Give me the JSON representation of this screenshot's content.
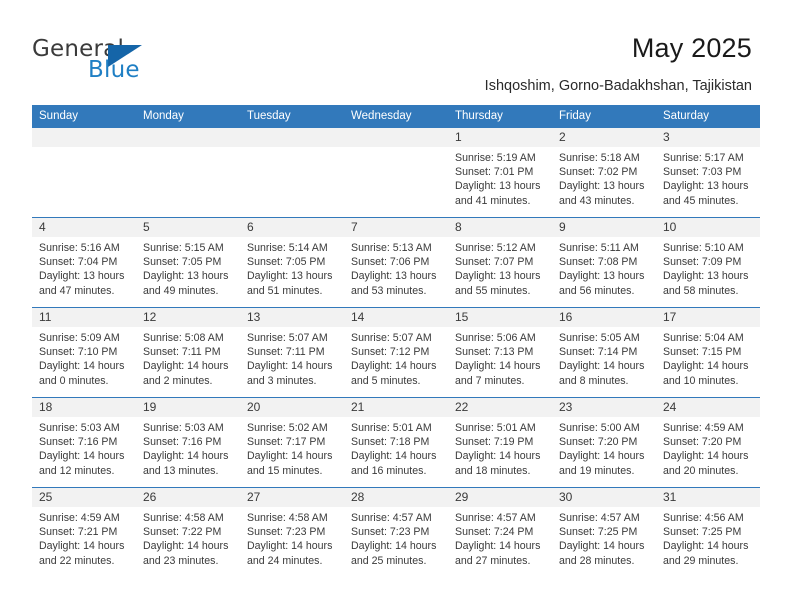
{
  "brand": {
    "name_top": "General",
    "name_bottom": "Blue",
    "triangle_color": "#1565a8",
    "blue_color": "#1f7fc4"
  },
  "header": {
    "title": "May 2025",
    "subtitle": "Ishqoshim, Gorno-Badakhshan, Tajikistan"
  },
  "theme": {
    "header_bg": "#3279bb",
    "daynum_bg": "#f2f2f2",
    "text": "#3a3a3a"
  },
  "calendar": {
    "weekday_headers": [
      "Sunday",
      "Monday",
      "Tuesday",
      "Wednesday",
      "Thursday",
      "Friday",
      "Saturday"
    ],
    "labels": {
      "sunrise": "Sunrise:",
      "sunset": "Sunset:",
      "daylight": "Daylight:"
    },
    "weeks": [
      [
        {
          "day": "",
          "empty": true
        },
        {
          "day": "",
          "empty": true
        },
        {
          "day": "",
          "empty": true
        },
        {
          "day": "",
          "empty": true
        },
        {
          "day": "1",
          "sunrise": "Sunrise: 5:19 AM",
          "sunset": "Sunset: 7:01 PM",
          "daylight": "Daylight: 13 hours and 41 minutes."
        },
        {
          "day": "2",
          "sunrise": "Sunrise: 5:18 AM",
          "sunset": "Sunset: 7:02 PM",
          "daylight": "Daylight: 13 hours and 43 minutes."
        },
        {
          "day": "3",
          "sunrise": "Sunrise: 5:17 AM",
          "sunset": "Sunset: 7:03 PM",
          "daylight": "Daylight: 13 hours and 45 minutes."
        }
      ],
      [
        {
          "day": "4",
          "sunrise": "Sunrise: 5:16 AM",
          "sunset": "Sunset: 7:04 PM",
          "daylight": "Daylight: 13 hours and 47 minutes."
        },
        {
          "day": "5",
          "sunrise": "Sunrise: 5:15 AM",
          "sunset": "Sunset: 7:05 PM",
          "daylight": "Daylight: 13 hours and 49 minutes."
        },
        {
          "day": "6",
          "sunrise": "Sunrise: 5:14 AM",
          "sunset": "Sunset: 7:05 PM",
          "daylight": "Daylight: 13 hours and 51 minutes."
        },
        {
          "day": "7",
          "sunrise": "Sunrise: 5:13 AM",
          "sunset": "Sunset: 7:06 PM",
          "daylight": "Daylight: 13 hours and 53 minutes."
        },
        {
          "day": "8",
          "sunrise": "Sunrise: 5:12 AM",
          "sunset": "Sunset: 7:07 PM",
          "daylight": "Daylight: 13 hours and 55 minutes."
        },
        {
          "day": "9",
          "sunrise": "Sunrise: 5:11 AM",
          "sunset": "Sunset: 7:08 PM",
          "daylight": "Daylight: 13 hours and 56 minutes."
        },
        {
          "day": "10",
          "sunrise": "Sunrise: 5:10 AM",
          "sunset": "Sunset: 7:09 PM",
          "daylight": "Daylight: 13 hours and 58 minutes."
        }
      ],
      [
        {
          "day": "11",
          "sunrise": "Sunrise: 5:09 AM",
          "sunset": "Sunset: 7:10 PM",
          "daylight": "Daylight: 14 hours and 0 minutes."
        },
        {
          "day": "12",
          "sunrise": "Sunrise: 5:08 AM",
          "sunset": "Sunset: 7:11 PM",
          "daylight": "Daylight: 14 hours and 2 minutes."
        },
        {
          "day": "13",
          "sunrise": "Sunrise: 5:07 AM",
          "sunset": "Sunset: 7:11 PM",
          "daylight": "Daylight: 14 hours and 3 minutes."
        },
        {
          "day": "14",
          "sunrise": "Sunrise: 5:07 AM",
          "sunset": "Sunset: 7:12 PM",
          "daylight": "Daylight: 14 hours and 5 minutes."
        },
        {
          "day": "15",
          "sunrise": "Sunrise: 5:06 AM",
          "sunset": "Sunset: 7:13 PM",
          "daylight": "Daylight: 14 hours and 7 minutes."
        },
        {
          "day": "16",
          "sunrise": "Sunrise: 5:05 AM",
          "sunset": "Sunset: 7:14 PM",
          "daylight": "Daylight: 14 hours and 8 minutes."
        },
        {
          "day": "17",
          "sunrise": "Sunrise: 5:04 AM",
          "sunset": "Sunset: 7:15 PM",
          "daylight": "Daylight: 14 hours and 10 minutes."
        }
      ],
      [
        {
          "day": "18",
          "sunrise": "Sunrise: 5:03 AM",
          "sunset": "Sunset: 7:16 PM",
          "daylight": "Daylight: 14 hours and 12 minutes."
        },
        {
          "day": "19",
          "sunrise": "Sunrise: 5:03 AM",
          "sunset": "Sunset: 7:16 PM",
          "daylight": "Daylight: 14 hours and 13 minutes."
        },
        {
          "day": "20",
          "sunrise": "Sunrise: 5:02 AM",
          "sunset": "Sunset: 7:17 PM",
          "daylight": "Daylight: 14 hours and 15 minutes."
        },
        {
          "day": "21",
          "sunrise": "Sunrise: 5:01 AM",
          "sunset": "Sunset: 7:18 PM",
          "daylight": "Daylight: 14 hours and 16 minutes."
        },
        {
          "day": "22",
          "sunrise": "Sunrise: 5:01 AM",
          "sunset": "Sunset: 7:19 PM",
          "daylight": "Daylight: 14 hours and 18 minutes."
        },
        {
          "day": "23",
          "sunrise": "Sunrise: 5:00 AM",
          "sunset": "Sunset: 7:20 PM",
          "daylight": "Daylight: 14 hours and 19 minutes."
        },
        {
          "day": "24",
          "sunrise": "Sunrise: 4:59 AM",
          "sunset": "Sunset: 7:20 PM",
          "daylight": "Daylight: 14 hours and 20 minutes."
        }
      ],
      [
        {
          "day": "25",
          "sunrise": "Sunrise: 4:59 AM",
          "sunset": "Sunset: 7:21 PM",
          "daylight": "Daylight: 14 hours and 22 minutes."
        },
        {
          "day": "26",
          "sunrise": "Sunrise: 4:58 AM",
          "sunset": "Sunset: 7:22 PM",
          "daylight": "Daylight: 14 hours and 23 minutes."
        },
        {
          "day": "27",
          "sunrise": "Sunrise: 4:58 AM",
          "sunset": "Sunset: 7:23 PM",
          "daylight": "Daylight: 14 hours and 24 minutes."
        },
        {
          "day": "28",
          "sunrise": "Sunrise: 4:57 AM",
          "sunset": "Sunset: 7:23 PM",
          "daylight": "Daylight: 14 hours and 25 minutes."
        },
        {
          "day": "29",
          "sunrise": "Sunrise: 4:57 AM",
          "sunset": "Sunset: 7:24 PM",
          "daylight": "Daylight: 14 hours and 27 minutes."
        },
        {
          "day": "30",
          "sunrise": "Sunrise: 4:57 AM",
          "sunset": "Sunset: 7:25 PM",
          "daylight": "Daylight: 14 hours and 28 minutes."
        },
        {
          "day": "31",
          "sunrise": "Sunrise: 4:56 AM",
          "sunset": "Sunset: 7:25 PM",
          "daylight": "Daylight: 14 hours and 29 minutes."
        }
      ]
    ]
  }
}
